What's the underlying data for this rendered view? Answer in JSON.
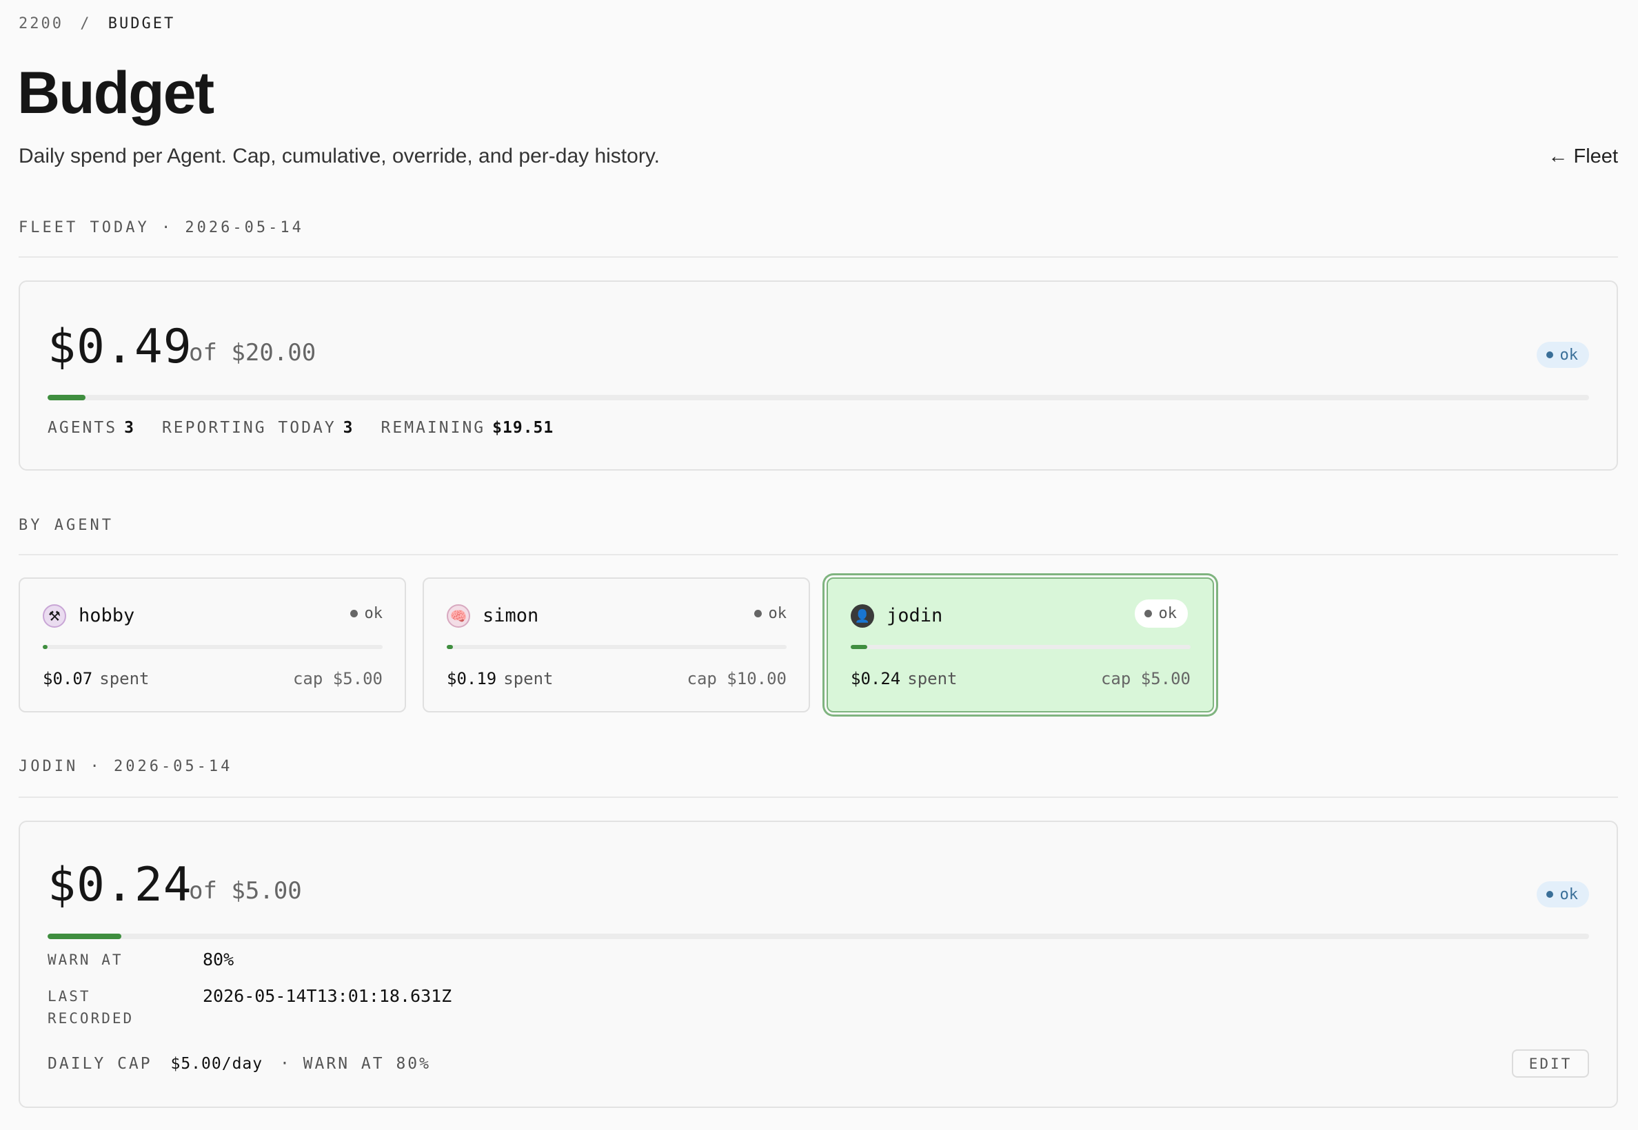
{
  "breadcrumb": {
    "root": "2200",
    "sep": "/",
    "current": "BUDGET"
  },
  "header": {
    "title": "Budget",
    "subtitle": "Daily spend per Agent. Cap, cumulative, override, and per-day history.",
    "back_link": "← Fleet"
  },
  "fleet": {
    "section_label": "FLEET TODAY · 2026-05-14",
    "spent": "$0.49",
    "of_cap": "of $20.00",
    "status": "ok",
    "progress_percent": 2.45,
    "stats": [
      {
        "label": "AGENTS",
        "value": "3"
      },
      {
        "label": "REPORTING TODAY",
        "value": "3"
      },
      {
        "label": "REMAINING",
        "value": "$19.51"
      }
    ]
  },
  "by_agent": {
    "section_label": "BY AGENT",
    "agents": [
      {
        "name": "hobby",
        "avatar": "tools-icon",
        "avatar_glyph": "⚒",
        "status": "ok",
        "spent": "$0.07",
        "spent_label": "spent",
        "cap": "cap $5.00",
        "progress_percent": 1.4,
        "selected": false
      },
      {
        "name": "simon",
        "avatar": "brain-icon",
        "avatar_glyph": "🧠",
        "status": "ok",
        "spent": "$0.19",
        "spent_label": "spent",
        "cap": "cap $10.00",
        "progress_percent": 1.9,
        "selected": false
      },
      {
        "name": "jodin",
        "avatar": "person-avatar",
        "avatar_glyph": "👤",
        "status": "ok",
        "spent": "$0.24",
        "spent_label": "spent",
        "cap": "cap $5.00",
        "progress_percent": 4.8,
        "selected": true
      }
    ]
  },
  "detail": {
    "section_label": "JODIN · 2026-05-14",
    "spent": "$0.24",
    "of_cap": "of $5.00",
    "status": "ok",
    "progress_percent": 4.8,
    "warn_at_label": "WARN AT",
    "warn_at_value": "80%",
    "last_recorded_label_1": "LAST",
    "last_recorded_label_2": "RECORDED",
    "last_recorded_value": "2026-05-14T13:01:18.631Z",
    "footer_daily_cap_label": "DAILY CAP",
    "footer_daily_cap_value": "$5.00/day",
    "footer_warn": "· WARN AT 80%",
    "edit_label": "EDIT"
  },
  "colors": {
    "accent_green": "#3f8e3f",
    "selected_bg": "#d9f6d9",
    "ok_pill_bg": "#e3effa",
    "ok_pill_text": "#3a6f98"
  }
}
